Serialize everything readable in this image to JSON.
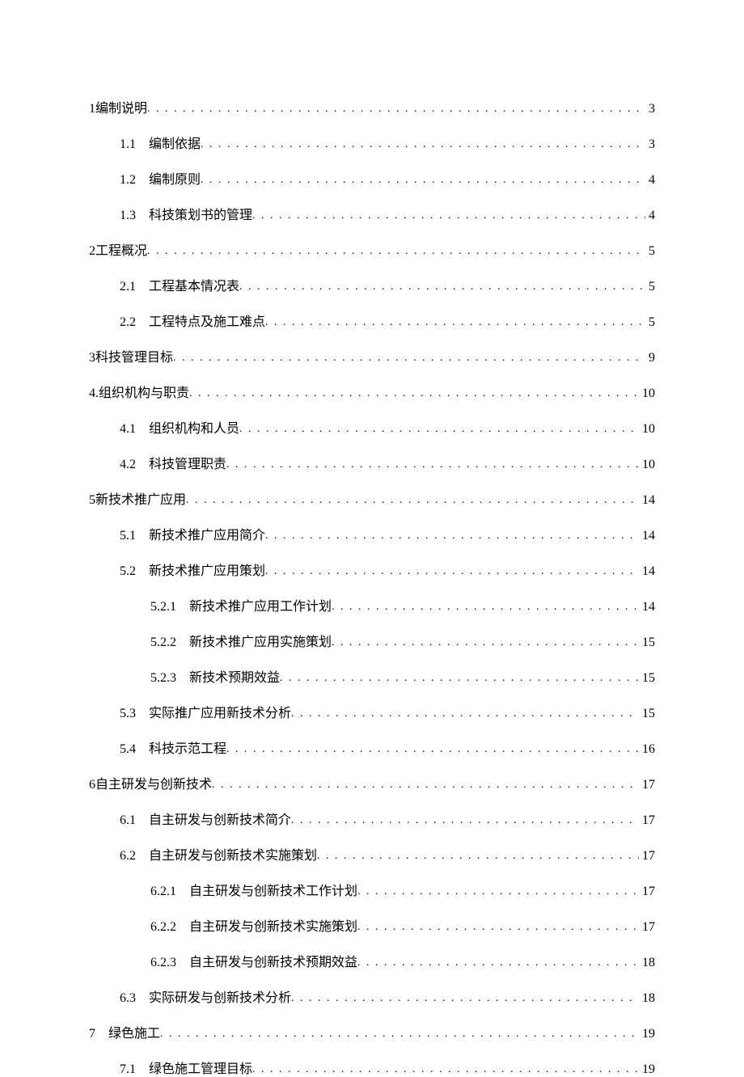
{
  "toc": [
    {
      "level": 0,
      "num": "1",
      "gap": " ",
      "title": "编制说明",
      "page": "3"
    },
    {
      "level": 1,
      "num": "1.1",
      "gap": "　",
      "title": "编制依据",
      "page": "3"
    },
    {
      "level": 1,
      "num": "1.2",
      "gap": "　",
      "title": "编制原则",
      "page": "4"
    },
    {
      "level": 1,
      "num": "1.3",
      "gap": "　",
      "title": "科技策划书的管理",
      "page": "4"
    },
    {
      "level": 0,
      "num": "2",
      "gap": " ",
      "title": "工程概况",
      "page": "5"
    },
    {
      "level": 1,
      "num": "2.1",
      "gap": "　",
      "title": "工程基本情况表",
      "page": "5"
    },
    {
      "level": 1,
      "num": "2.2",
      "gap": "　",
      "title": "工程特点及施工难点",
      "page": "5"
    },
    {
      "level": 0,
      "num": "3",
      "gap": " ",
      "title": "科技管理目标",
      "page": "9"
    },
    {
      "level": 0,
      "num": "4.",
      "gap": " ",
      "title": "组织机构与职责 ",
      "page": "10"
    },
    {
      "level": 1,
      "num": "4.1",
      "gap": "　",
      "title": "组织机构和人员",
      "page": "10"
    },
    {
      "level": 1,
      "num": "4.2",
      "gap": "　",
      "title": "科技管理职责",
      "page": "10"
    },
    {
      "level": 0,
      "num": "5",
      "gap": " ",
      "title": "新技术推广应用",
      "page": "14"
    },
    {
      "level": 1,
      "num": "5.1",
      "gap": "　",
      "title": "新技术推广应用简介",
      "page": "14"
    },
    {
      "level": 1,
      "num": "5.2",
      "gap": "　",
      "title": "新技术推广应用策划",
      "page": "14"
    },
    {
      "level": 2,
      "num": "5.2.1",
      "gap": "　",
      "title": "新技术推广应用工作计划",
      "page": "14"
    },
    {
      "level": 2,
      "num": "5.2.2",
      "gap": "　",
      "title": "新技术推广应用实施策划",
      "page": "15"
    },
    {
      "level": 2,
      "num": "5.2.3",
      "gap": "　",
      "title": "新技术预期效益",
      "page": "15"
    },
    {
      "level": 1,
      "num": "5.3",
      "gap": "　",
      "title": "实际推广应用新技术分析",
      "page": "15"
    },
    {
      "level": 1,
      "num": "5.4",
      "gap": "　",
      "title": "科技示范工程",
      "page": "16"
    },
    {
      "level": 0,
      "num": "6",
      "gap": " ",
      "title": "自主研发与创新技术",
      "page": "17"
    },
    {
      "level": 1,
      "num": "6.1",
      "gap": "　",
      "title": "自主研发与创新技术简介",
      "page": "17"
    },
    {
      "level": 1,
      "num": "6.2",
      "gap": "　",
      "title": "自主研发与创新技术实施策划",
      "page": "17"
    },
    {
      "level": 2,
      "num": "6.2.1",
      "gap": "　",
      "title": "自主研发与创新技术工作计划",
      "page": "17"
    },
    {
      "level": 2,
      "num": "6.2.2",
      "gap": "　",
      "title": "自主研发与创新技术实施策划",
      "page": "17"
    },
    {
      "level": 2,
      "num": "6.2.3",
      "gap": "　",
      "title": "自主研发与创新技术预期效益",
      "page": "18"
    },
    {
      "level": 1,
      "num": "6.3",
      "gap": "　",
      "title": "实际研发与创新技术分析",
      "page": "18"
    },
    {
      "level": 0,
      "num": "7",
      "gap": "　",
      "title": "绿色施工 ",
      "page": "19"
    },
    {
      "level": 1,
      "num": "7.1",
      "gap": "　",
      "title": "绿色施工管理目标",
      "page": "19"
    }
  ]
}
